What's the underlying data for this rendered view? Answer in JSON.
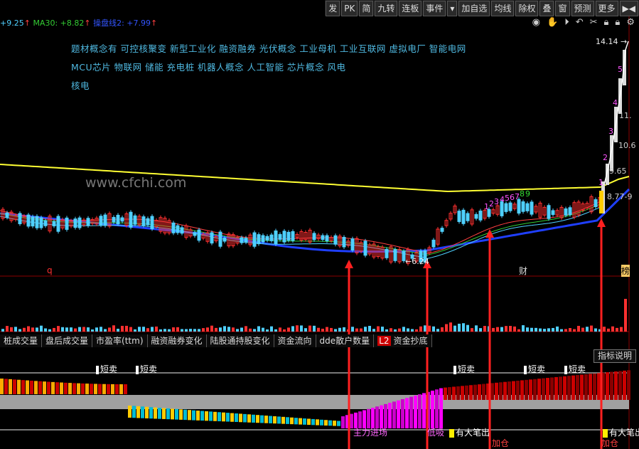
{
  "toolbar": {
    "items": [
      "发",
      "PK",
      "简",
      "九转",
      "连板",
      "事件",
      "加自选",
      "均线",
      "除权",
      "叠",
      "窗",
      "预测",
      "更多"
    ],
    "scroll_arrows": "▶◀"
  },
  "ma_row": {
    "seg1": "+9.25",
    "seg2": "MA30: +8.82",
    "seg3": "操盘线2: +7.99",
    "colors": {
      "seg1": "#4fd0ff",
      "seg2": "#33cc33",
      "seg3": "#3355ff",
      "arrow": "#ff4040"
    }
  },
  "concepts": {
    "line1": "题材概念有  可控核聚变  新型工业化  融资融券  光伏概念  工业母机  工业互联网  虚拟电厂  智能电网",
    "line2": "MCU芯片  物联网  储能  充电桩  机器人概念  人工智能  芯片概念  风电",
    "line3": "核电"
  },
  "price_axis": {
    "top": "14.14",
    "labels": [
      "11.",
      "10.6",
      "9.65",
      "8.77-9"
    ],
    "low": "6.24"
  },
  "nine_turn": [
    "1",
    "2",
    "3",
    "4",
    "5",
    "6",
    "7",
    "8",
    "9"
  ],
  "right_count": [
    "1",
    "2",
    "3",
    "4",
    "5"
  ],
  "markers": {
    "q": "q",
    "cai": "财",
    "bang": "榜"
  },
  "watermark": "www.cfchi.com",
  "tabs": [
    "桩成交量",
    "盘后成交量",
    "市盈率(ttm)",
    "融资融券变化",
    "陆股通持股变化",
    "资金流向",
    "dde散户数量",
    "资金抄底"
  ],
  "l2_badge": "L2",
  "explain_button": "指标说明",
  "signals": {
    "sell": "短卖",
    "main_in": "主力进场",
    "low_buy": "低吸",
    "big_out": "有大笔出",
    "add": "加仓"
  }
}
